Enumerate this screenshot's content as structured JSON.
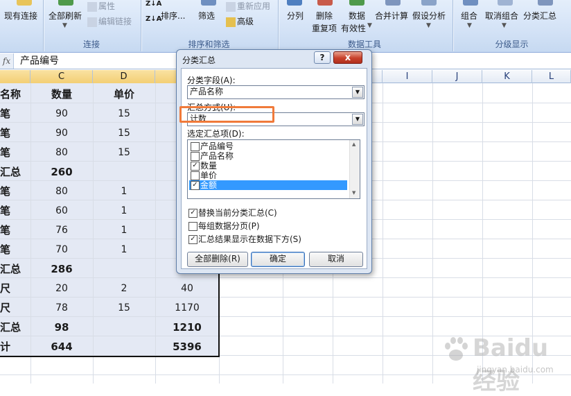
{
  "ribbon": {
    "groups": [
      {
        "name": "connections",
        "title": "连接"
      },
      {
        "name": "sort-filter",
        "title": "排序和筛选"
      },
      {
        "name": "data-tools",
        "title": "数据工具"
      },
      {
        "name": "outline",
        "title": "分级显示"
      }
    ],
    "buttons": {
      "existing_connections": "现有连接",
      "refresh_all": "全部刷新",
      "properties": "属性",
      "edit_links": "编辑链接",
      "sort": "排序...",
      "filter": "筛选",
      "reapply": "重新应用",
      "advanced": "高级",
      "text_to_columns": "分列",
      "remove_duplicates_1": "删除",
      "remove_duplicates_2": "重复项",
      "data_validation_1": "数据",
      "data_validation_2": "有效性",
      "consolidate": "合并计算",
      "what_if": "假设分析",
      "group": "组合",
      "ungroup": "取消组合",
      "subtotal": "分类汇总"
    }
  },
  "formula_bar": {
    "fx": "fx",
    "content": "产品编号"
  },
  "columns": [
    "C",
    "D",
    "I",
    "J",
    "K",
    "L"
  ],
  "table": {
    "header": {
      "name": "名称",
      "qty": "数量",
      "price": "单价"
    },
    "rows": [
      {
        "name": "笔",
        "qty": "90",
        "price": "15",
        "amount": ""
      },
      {
        "name": "笔",
        "qty": "90",
        "price": "15",
        "amount": ""
      },
      {
        "name": "笔",
        "qty": "80",
        "price": "15",
        "amount": ""
      },
      {
        "name": "汇总",
        "qty": "260",
        "price": "",
        "amount": ""
      },
      {
        "name": "笔",
        "qty": "80",
        "price": "1",
        "amount": ""
      },
      {
        "name": "笔",
        "qty": "60",
        "price": "1",
        "amount": ""
      },
      {
        "name": "笔",
        "qty": "76",
        "price": "1",
        "amount": ""
      },
      {
        "name": "笔",
        "qty": "70",
        "price": "1",
        "amount": ""
      },
      {
        "name": "汇总",
        "qty": "286",
        "price": "",
        "amount": ""
      },
      {
        "name": "尺",
        "qty": "20",
        "price": "2",
        "amount": "40"
      },
      {
        "name": "尺",
        "qty": "78",
        "price": "15",
        "amount": "1170"
      },
      {
        "name": "汇总",
        "qty": "98",
        "price": "",
        "amount": "1210"
      },
      {
        "name": "计",
        "qty": "644",
        "price": "",
        "amount": "5396"
      }
    ]
  },
  "dialog": {
    "title": "分类汇总",
    "help": "?",
    "close": "x",
    "field_label": "分类字段(A):",
    "field_value": "产品名称",
    "method_label": "汇总方式(U):",
    "method_value": "计数",
    "items_label": "选定汇总项(D):",
    "items": [
      {
        "label": "产品编号",
        "checked": ""
      },
      {
        "label": "产品名称",
        "checked": ""
      },
      {
        "label": "数量",
        "checked": "✓"
      },
      {
        "label": "单价",
        "checked": ""
      },
      {
        "label": "金额",
        "checked": "✓"
      }
    ],
    "replace_current": "替换当前分类汇总(C)",
    "page_break": "每组数据分页(P)",
    "summary_below": "汇总结果显示在数据下方(S)",
    "replace_checked": "✓",
    "page_break_checked": "",
    "summary_checked": "✓",
    "remove_all": "全部删除(R)",
    "ok": "确定",
    "cancel": "取消"
  },
  "watermark": {
    "brand": "Baidu 经验",
    "url": "jingyan.baidu.com"
  },
  "colors": {
    "accent": "#3399ff",
    "highlight": "#f07a3a",
    "close": "#c8412b"
  }
}
